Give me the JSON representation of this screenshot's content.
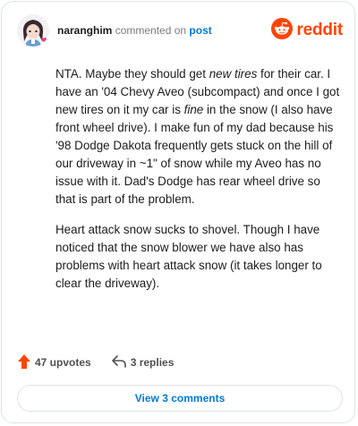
{
  "header": {
    "username": "naranghim",
    "action_text": "commented on",
    "post_link": "post",
    "brand": "reddit"
  },
  "comment": {
    "p1_a": "NTA. Maybe they should get ",
    "p1_em1": "new tires",
    "p1_b": " for their car. I have an '04 Chevy Aveo (subcompact) and once I got new tires on it my car is ",
    "p1_em2": "fine",
    "p1_c": " in the snow (I also have front wheel drive). I make fun of my dad because his '98 Dodge Dakota frequently gets stuck on the hill of our driveway in ~1\" of snow while my Aveo has no issue with it. Dad's Dodge has rear wheel drive so that is part of the problem.",
    "p2": "Heart attack snow sucks to shovel. Though I have noticed that the snow blower we have also has problems with heart attack snow (it takes longer to clear the driveway)."
  },
  "actions": {
    "upvotes": "47 upvotes",
    "replies": "3 replies"
  },
  "footer": {
    "view_comments": "View 3 comments"
  },
  "colors": {
    "brand": "#ff4500",
    "link": "#0079d3",
    "muted": "#7c7c7c",
    "border": "#dfe3e6"
  },
  "icons": [
    "user-avatar",
    "reddit-logo-icon",
    "upvote-arrow-icon",
    "reply-arrow-icon"
  ]
}
